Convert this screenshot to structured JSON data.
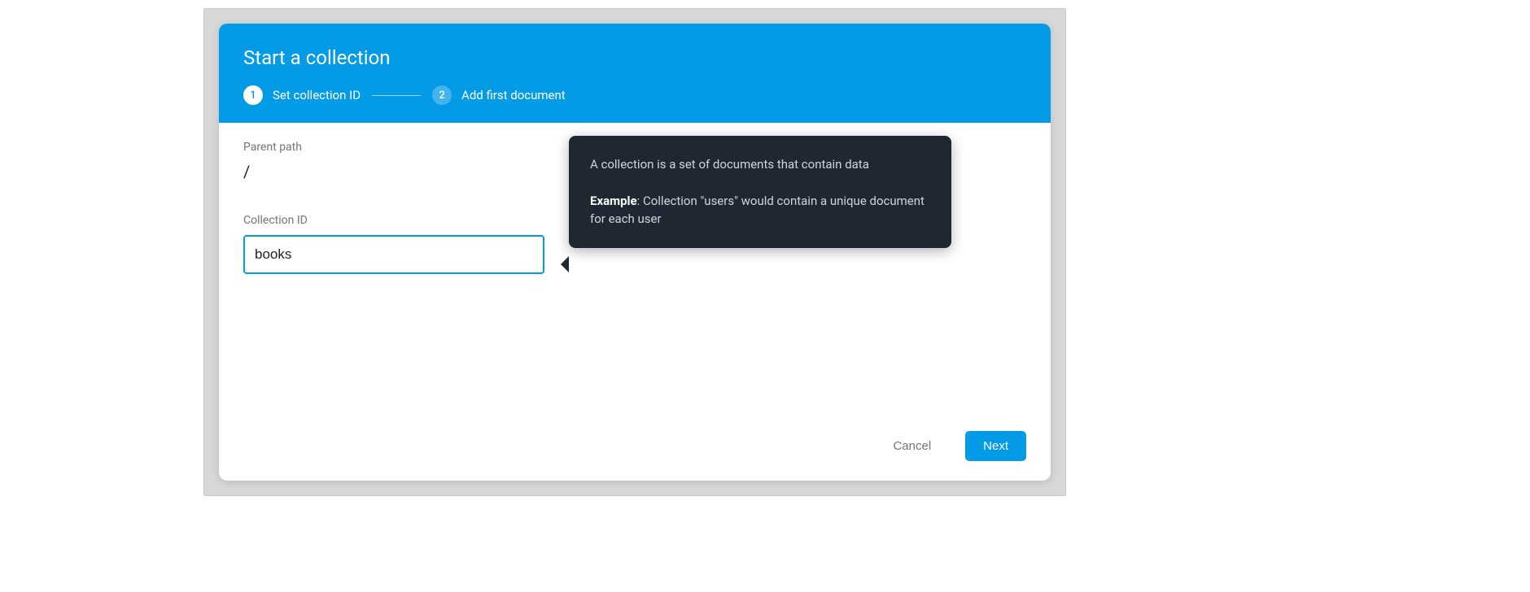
{
  "dialog": {
    "title": "Start a collection",
    "steps": [
      {
        "num": "1",
        "label": "Set collection ID",
        "active": true
      },
      {
        "num": "2",
        "label": "Add first document",
        "active": false
      }
    ],
    "parent_path_label": "Parent path",
    "parent_path_value": "/",
    "collection_id_label": "Collection ID",
    "collection_id_value": "books",
    "tooltip": {
      "desc": "A collection is a set of documents that contain data",
      "example_label": "Example",
      "example_text": ": Collection \"users\" would contain a unique document for each user"
    },
    "cancel_label": "Cancel",
    "next_label": "Next"
  }
}
